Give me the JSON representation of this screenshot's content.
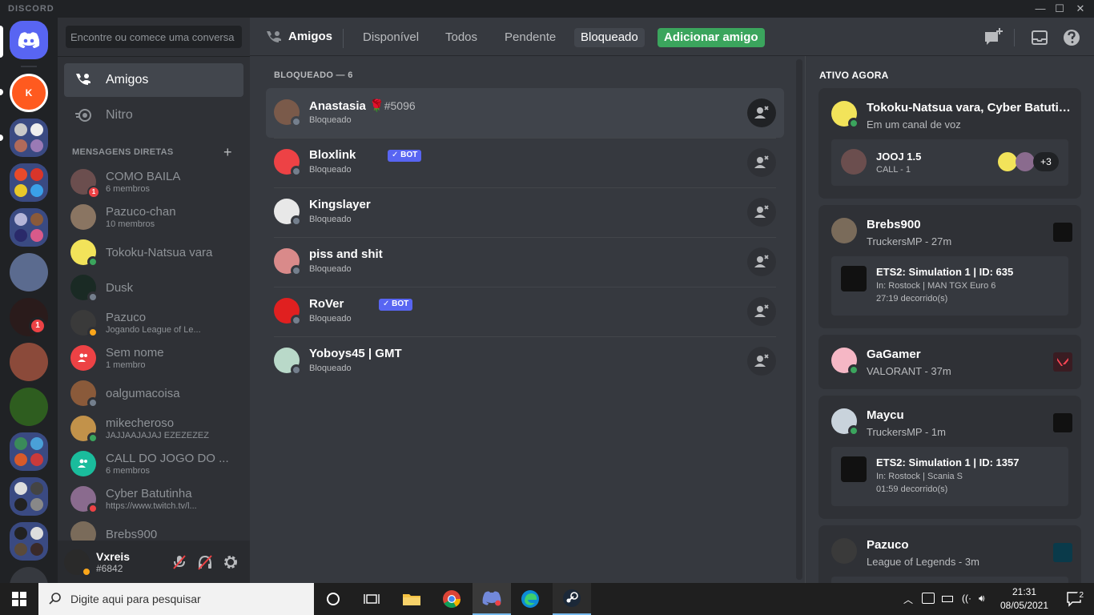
{
  "app": {
    "brand": "DISCORD"
  },
  "window_controls": {
    "minimize": "—",
    "maximize": "☐",
    "close": "✕"
  },
  "guilds": [
    {
      "name": "home",
      "color": "#5865f2"
    },
    {
      "name": "KLei",
      "color": "#ff5a1f",
      "badge": ""
    },
    {
      "name": "folder-1"
    },
    {
      "name": "folder-2"
    },
    {
      "name": "folder-3"
    },
    {
      "name": "anime-server",
      "color": "#5b6b8f"
    },
    {
      "name": "server-badge",
      "color": "#2a1b1b",
      "badge": "1"
    },
    {
      "name": "server-sunset",
      "color": "#8b4a3a"
    },
    {
      "name": "server-green",
      "color": "#2e5d1f"
    },
    {
      "name": "folder-4"
    },
    {
      "name": "folder-5"
    },
    {
      "name": "folder-6"
    }
  ],
  "sidebar": {
    "search_placeholder": "Encontre ou comece uma conversa",
    "nav": [
      {
        "label": "Amigos"
      },
      {
        "label": "Nitro"
      }
    ],
    "dm_header": "MENSAGENS DIRETAS",
    "dm_add": "+",
    "dms": [
      {
        "name": "COMO BAILA",
        "sub": "6 membros",
        "color": "#6b4e4e",
        "badge": "1"
      },
      {
        "name": "Pazuco-chan",
        "sub": "10 membros",
        "color": "#8a7562"
      },
      {
        "name": "Tokoku-Natsua vara",
        "sub": "",
        "color": "#f2e35a",
        "status": "#3ba55d"
      },
      {
        "name": "Dusk",
        "sub": "",
        "color": "#1a2a24",
        "status": "#747f8d"
      },
      {
        "name": "Pazuco",
        "sub": "Jogando League of Le...",
        "color": "#3a3a3a",
        "status": "#faa61a"
      },
      {
        "name": "Sem nome",
        "sub": "1 membro",
        "color": "#ed4245"
      },
      {
        "name": "oalgumacoisa",
        "sub": "",
        "color": "#8a5a3a",
        "status": "#747f8d"
      },
      {
        "name": "mikecheroso",
        "sub": "JAJJAAJAJAJ EZEZEZEZ",
        "color": "#c2924a",
        "status": "#3ba55d"
      },
      {
        "name": "CALL DO JOGO DO ...",
        "sub": "6 membros",
        "color": "#1abc9c"
      },
      {
        "name": "Cyber Batutinha",
        "sub": "https://www.twitch.tv/l...",
        "color": "#8a6b8e",
        "status": "#ed4245"
      },
      {
        "name": "Brebs900",
        "sub": "",
        "color": "#7a6b5a"
      }
    ]
  },
  "user": {
    "name": "Vxreis",
    "discriminator": "#6842",
    "color": "#2a2a2a",
    "status": "#faa61a"
  },
  "header": {
    "title": "Amigos",
    "tabs": [
      {
        "label": "Disponível"
      },
      {
        "label": "Todos"
      },
      {
        "label": "Pendente"
      },
      {
        "label": "Bloqueado"
      },
      {
        "label": "Adicionar amigo"
      }
    ]
  },
  "friends": {
    "list_header": "BLOQUEADO — 6",
    "items": [
      {
        "name": "Anastasia",
        "emoji": "🌹",
        "tag": "#5096",
        "status": "Bloqueado",
        "bot": false,
        "color": "#7a5a4a"
      },
      {
        "name": "Bloxlink",
        "emoji": "",
        "tag": "",
        "status": "Bloqueado",
        "bot": true,
        "color": "#ed4245"
      },
      {
        "name": "Kingslayer",
        "emoji": "",
        "tag": "",
        "status": "Bloqueado",
        "bot": false,
        "color": "#e8e8e8"
      },
      {
        "name": "piss and shit",
        "emoji": "",
        "tag": "",
        "status": "Bloqueado",
        "bot": false,
        "color": "#d98a8a"
      },
      {
        "name": "RoVer",
        "emoji": "",
        "tag": "",
        "status": "Bloqueado",
        "bot": true,
        "color": "#e02020"
      },
      {
        "name": "Yoboys45 | GMT",
        "emoji": "",
        "tag": "",
        "status": "Bloqueado",
        "bot": false,
        "color": "#b9d9c9"
      }
    ],
    "bot_label": "✓ BOT"
  },
  "active_now": {
    "header": "ATIVO AGORA",
    "cards": [
      {
        "name": "Tokoku-Natsua vara, Cyber Batutinha...",
        "sub": "Em um canal de voz",
        "color": "#f2e35a",
        "voice": {
          "title": "JOOJ 1.5",
          "sub": "CALL - 1",
          "more": "+3"
        }
      },
      {
        "name": "Brebs900",
        "sub": "TruckersMP - 27m",
        "color": "#7a6b5a",
        "game": {
          "title": "ETS2: Simulation 1 | ID: 635",
          "line1": "In: Rostock | MAN TGX Euro 6",
          "line2": "27:19 decorrido(s)"
        }
      },
      {
        "name": "GaGamer",
        "sub": "VALORANT - 37m",
        "color": "#f5b7c5"
      },
      {
        "name": "Maycu",
        "sub": "TruckersMP - 1m",
        "color": "#c9d3dc",
        "game": {
          "title": "ETS2: Simulation 1 | ID: 1357",
          "line1": "In: Rostock | Scania S",
          "line2": "01:59 decorrido(s)"
        }
      },
      {
        "name": "Pazuco",
        "sub": "League of Legends - 3m",
        "color": "#3a3a3a"
      }
    ]
  },
  "taskbar": {
    "search_placeholder": "Digite aqui para pesquisar",
    "time": "21:31",
    "date": "08/05/2021",
    "notifications": "2"
  }
}
